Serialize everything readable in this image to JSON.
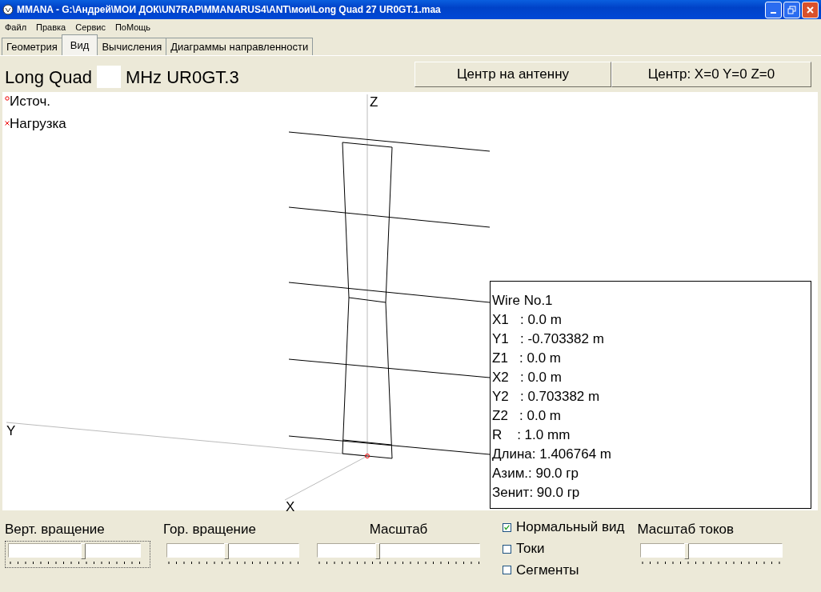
{
  "window": {
    "title": "MMANA - G:\\Андрей\\МОИ ДОК\\UN7RAP\\MMANARUS4\\ANT\\мои\\Long Quad 27 UR0GT.1.maa"
  },
  "menu": [
    "Файл",
    "Правка",
    "Сервис",
    "ПоМощь"
  ],
  "tabs": [
    {
      "label": "Геометрия",
      "selected": false
    },
    {
      "label": "Вид",
      "selected": true
    },
    {
      "label": "Вычисления",
      "selected": false
    },
    {
      "label": "Диаграммы направленности",
      "selected": false
    }
  ],
  "header": {
    "model_name": "Long Quad",
    "frequency_unit": "MHz UR0GT.3",
    "buttons": [
      "Центр на антенну",
      "Центр: X=0 Y=0 Z=0"
    ]
  },
  "view": {
    "legend": [
      {
        "kind": "source",
        "label": "Источ."
      },
      {
        "kind": "load",
        "label": "Нагрузка"
      }
    ],
    "axes": {
      "z": "Z",
      "y": "Y",
      "x": "X"
    },
    "wire_info": [
      "Wire No.1",
      "X1   : 0.0 m",
      "Y1   : -0.703382 m",
      "Z1   : 0.0 m",
      "X2   : 0.0 m",
      "Y2   : 0.703382 m",
      "Z2   : 0.0 m",
      "R    : 1.0 mm",
      "Длина: 1.406764 m",
      "Азим.: 90.0 гр",
      "Зенит: 90.0 гр"
    ]
  },
  "controls": {
    "sliders": [
      {
        "label": "Верт. вращение",
        "level": 0.57,
        "focused": true
      },
      {
        "label": "Гор. вращение",
        "level": 0.45,
        "focused": false
      },
      {
        "label": "Масштаб",
        "level": 0.37,
        "focused": false
      },
      {
        "label": "Масштаб токов",
        "level": 0.32,
        "focused": false
      }
    ],
    "checkboxes": [
      {
        "label": "Нормальный вид",
        "checked": true
      },
      {
        "label": "Токи",
        "checked": false
      },
      {
        "label": "Сегменты",
        "checked": false
      }
    ]
  }
}
